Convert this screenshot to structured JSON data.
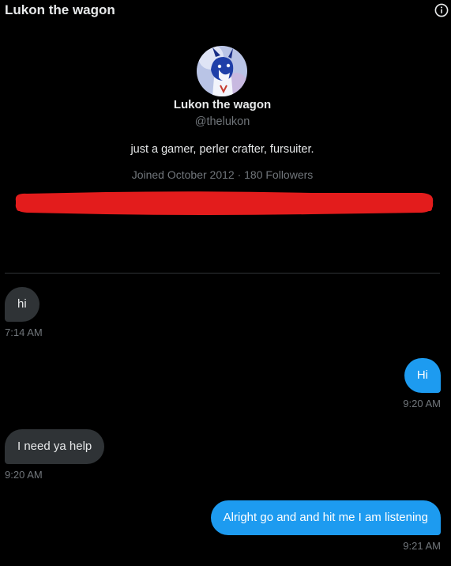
{
  "header": {
    "title": "Lukon the wagon",
    "info_icon": "info-circle-icon"
  },
  "profile": {
    "display_name": "Lukon the wagon",
    "handle": "@thelukon",
    "bio": "just a gamer, perler crafter, fursuiter.",
    "joined_followers": "Joined October 2012 · 180 Followers",
    "redaction_color": "#e31c1c"
  },
  "messages": [
    {
      "direction": "incoming",
      "text": "hi",
      "time": "7:14 AM"
    },
    {
      "direction": "outgoing",
      "text": "Hi",
      "time": "9:20 AM"
    },
    {
      "direction": "incoming",
      "text": "I need ya help",
      "time": "9:20 AM"
    },
    {
      "direction": "outgoing",
      "text": "Alright  go and and hit me I am listening",
      "time": "9:21 AM"
    }
  ],
  "colors": {
    "background": "#000000",
    "incoming_bubble": "#2f3336",
    "outgoing_bubble": "#1d9bf0",
    "primary_text": "#e7e9ea",
    "secondary_text": "#71767b"
  }
}
